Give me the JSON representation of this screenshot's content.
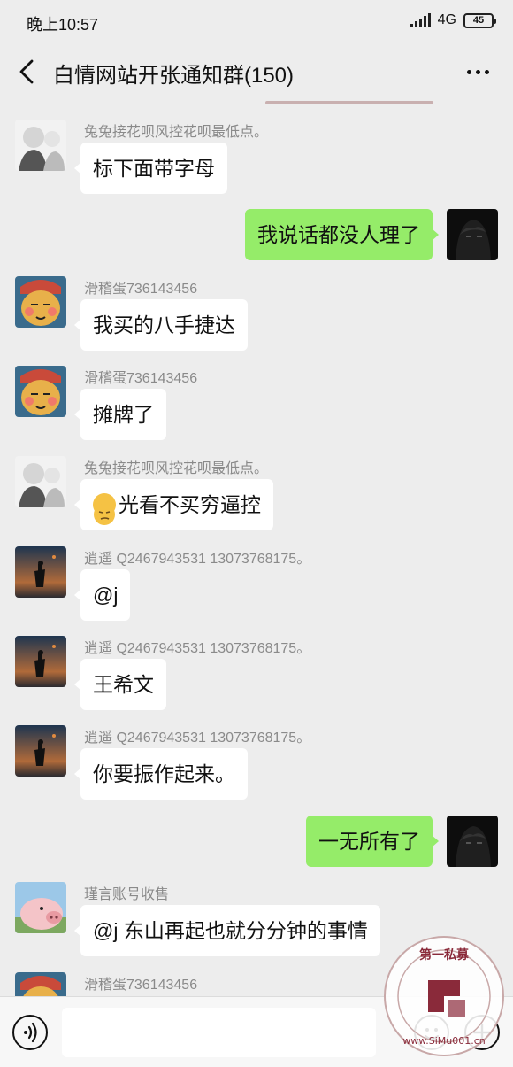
{
  "status_bar": {
    "time": "晚上10:57",
    "network": "4G",
    "battery": "45"
  },
  "header": {
    "title": "白情网站开张通知群(150)",
    "back_icon": "back-arrow-icon",
    "more_icon": "more-dots-icon"
  },
  "messages": [
    {
      "side": "left",
      "sender": "兔兔接花呗风控花呗最低点。",
      "text": "标下面带字母",
      "avatar": "anime-sketch-avatar"
    },
    {
      "side": "right",
      "sender": "",
      "text": "我说话都没人理了",
      "avatar": "dark-anime-avatar"
    },
    {
      "side": "left",
      "sender": "滑稽蛋736143456",
      "text": "我买的八手捷达",
      "avatar": "funny-egg-avatar"
    },
    {
      "side": "left",
      "sender": "滑稽蛋736143456",
      "text": "摊牌了",
      "avatar": "funny-egg-avatar"
    },
    {
      "side": "left",
      "sender": "兔兔接花呗风控花呗最低点。",
      "text": "光看不买穷逼控",
      "emoji": "smirk-emoji",
      "avatar": "anime-sketch-avatar"
    },
    {
      "side": "left",
      "sender": "逍遥   Q2467943531  13073768175。",
      "text": "@j",
      "avatar": "dusk-landscape-avatar"
    },
    {
      "side": "left",
      "sender": "逍遥   Q2467943531  13073768175。",
      "text": "王希文",
      "avatar": "dusk-landscape-avatar"
    },
    {
      "side": "left",
      "sender": "逍遥   Q2467943531  13073768175。",
      "text": "你要振作起来。",
      "avatar": "dusk-landscape-avatar"
    },
    {
      "side": "right",
      "sender": "",
      "text": "一无所有了",
      "avatar": "dark-anime-avatar"
    },
    {
      "side": "left",
      "sender": "瑾言账号收售",
      "text": "@j  东山再起也就分分钟的事情",
      "avatar": "pig-avatar"
    },
    {
      "side": "left",
      "sender": "滑稽蛋736143456",
      "text": "",
      "avatar": "funny-egg-avatar"
    }
  ],
  "input_bar": {
    "placeholder": "",
    "voice_icon": "voice-icon",
    "emoji_icon": "emoji-icon",
    "plus_icon": "plus-icon"
  },
  "watermark": {
    "text": "第一私募 www.SiMu001.cn"
  }
}
